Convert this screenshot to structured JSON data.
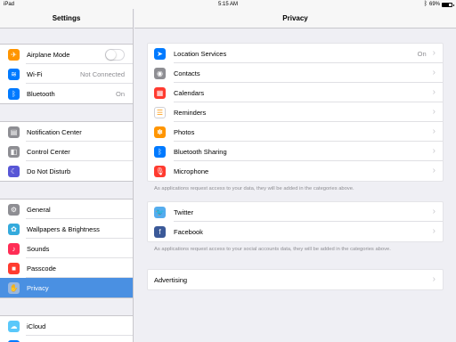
{
  "status_bar": {
    "device": "iPad",
    "time": "5:15 AM",
    "battery": "69%"
  },
  "sidebar": {
    "title": "Settings",
    "groups": [
      [
        {
          "label": "Airplane Mode",
          "icon": "airplane-icon",
          "color": "#ff9500",
          "glyph": "✈",
          "toggle": true
        },
        {
          "label": "Wi-Fi",
          "icon": "wifi-icon",
          "color": "#007aff",
          "glyph": "≋",
          "value": "Not Connected"
        },
        {
          "label": "Bluetooth",
          "icon": "bluetooth-icon",
          "color": "#007aff",
          "glyph": "ᛒ",
          "value": "On"
        }
      ],
      [
        {
          "label": "Notification Center",
          "icon": "notification-center-icon",
          "color": "#8e8e93",
          "glyph": "▤"
        },
        {
          "label": "Control Center",
          "icon": "control-center-icon",
          "color": "#8e8e93",
          "glyph": "◧"
        },
        {
          "label": "Do Not Disturb",
          "icon": "moon-icon",
          "color": "#5856d6",
          "glyph": "☾"
        }
      ],
      [
        {
          "label": "General",
          "icon": "gear-icon",
          "color": "#8e8e93",
          "glyph": "⚙"
        },
        {
          "label": "Wallpapers & Brightness",
          "icon": "wallpaper-icon",
          "color": "#34aadc",
          "glyph": "✿"
        },
        {
          "label": "Sounds",
          "icon": "speaker-icon",
          "color": "#ff2d55",
          "glyph": "♪"
        },
        {
          "label": "Passcode",
          "icon": "lock-icon",
          "color": "#ff3b30",
          "glyph": "■"
        },
        {
          "label": "Privacy",
          "icon": "hand-icon",
          "color": "#9ab8df",
          "glyph": "✋",
          "selected": true
        }
      ],
      [
        {
          "label": "iCloud",
          "icon": "cloud-icon",
          "color": "#5ac8fa",
          "glyph": "☁"
        },
        {
          "label": "Mail, Contacts, Calendars",
          "icon": "mail-icon",
          "color": "#007aff",
          "glyph": "✉"
        }
      ]
    ]
  },
  "main": {
    "title": "Privacy",
    "apps": [
      {
        "label": "Location Services",
        "icon": "location-arrow-icon",
        "color": "#007aff",
        "glyph": "➤",
        "value": "On"
      },
      {
        "label": "Contacts",
        "icon": "contacts-icon",
        "color": "#8e8e93",
        "glyph": "◉"
      },
      {
        "label": "Calendars",
        "icon": "calendar-icon",
        "color": "#ff3b30",
        "glyph": "▦"
      },
      {
        "label": "Reminders",
        "icon": "reminders-icon",
        "color": "#ffffff",
        "glyph": "☰",
        "dark": true
      },
      {
        "label": "Photos",
        "icon": "photos-icon",
        "color": "#ff9500",
        "glyph": "✽"
      },
      {
        "label": "Bluetooth Sharing",
        "icon": "bluetooth-icon",
        "color": "#007aff",
        "glyph": "ᛒ"
      },
      {
        "label": "Microphone",
        "icon": "microphone-icon",
        "color": "#ff3b30",
        "glyph": "🎙"
      }
    ],
    "apps_footnote": "As applications request access to your data, they will be added in the categories above.",
    "social": [
      {
        "label": "Twitter",
        "icon": "twitter-icon",
        "color": "#55acee",
        "glyph": "🐦",
        "light": true
      },
      {
        "label": "Facebook",
        "icon": "facebook-icon",
        "color": "#3b5998",
        "glyph": "f"
      }
    ],
    "social_footnote": "As applications request access to your social accounts data, they will be added in the categories above.",
    "advertising": "Advertising"
  }
}
